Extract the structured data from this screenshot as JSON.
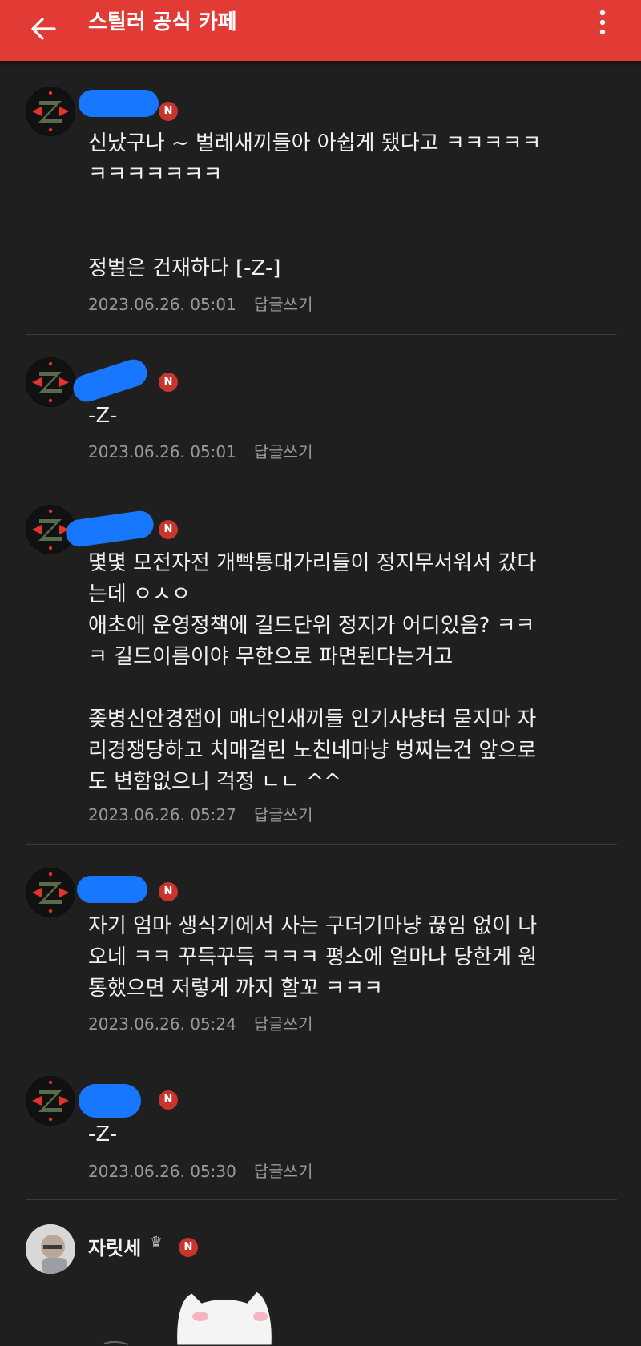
{
  "header": {
    "title": "스틸러 공식 카페",
    "back_icon": "arrow-left-icon",
    "menu_icon": "more-vertical-icon"
  },
  "colors": {
    "header_bg": "#e23b36",
    "page_bg": "#1f1f20",
    "redaction": "#1877ff",
    "badge": "#c8352f"
  },
  "comments": [
    {
      "badge": "N",
      "text": "신났구나 ~ 벌레새끼들아 아쉽게 됐다고 ㅋㅋㅋㅋㅋ\nㅋㅋㅋㅋㅋㅋㅋ\n\n\n정벌은 건재하다 [-Z-]",
      "date": "2023.06.26. 05:01",
      "reply": "답글쓰기"
    },
    {
      "badge": "N",
      "text": "-Z-",
      "date": "2023.06.26. 05:01",
      "reply": "답글쓰기"
    },
    {
      "badge": "N",
      "text": "몇몇 모전자전 개빡통대가리들이 정지무서워서 갔다\n는데 ㅇㅅㅇ\n애초에 운영정책에 길드단위 정지가 어디있음? ㅋㅋ\nㅋ 길드이름이야 무한으로 파면된다는거고\n\n좆병신안경잽이 매너인새끼들 인기사냥터 묻지마 자\n리경쟁당하고 치매걸린 노친네마냥 벙찌는건 앞으로\n도 변함없으니 걱정 ㄴㄴ ^^",
      "date": "2023.06.26. 05:27",
      "reply": "답글쓰기"
    },
    {
      "badge": "N",
      "text": "자기 엄마 생식기에서 사는 구더기마냥 끊임 없이 나\n오네 ㅋㅋ 꾸득꾸득 ㅋㅋㅋ 평소에 얼마나 당한게 원\n통했으면 저렇게 까지 할꼬 ㅋㅋㅋ",
      "date": "2023.06.26. 05:24",
      "reply": "답글쓰기"
    },
    {
      "badge": "N",
      "text": "-Z-",
      "date": "2023.06.26. 05:30",
      "reply": "답글쓰기"
    },
    {
      "username": "자릿세",
      "badge": "N"
    }
  ]
}
